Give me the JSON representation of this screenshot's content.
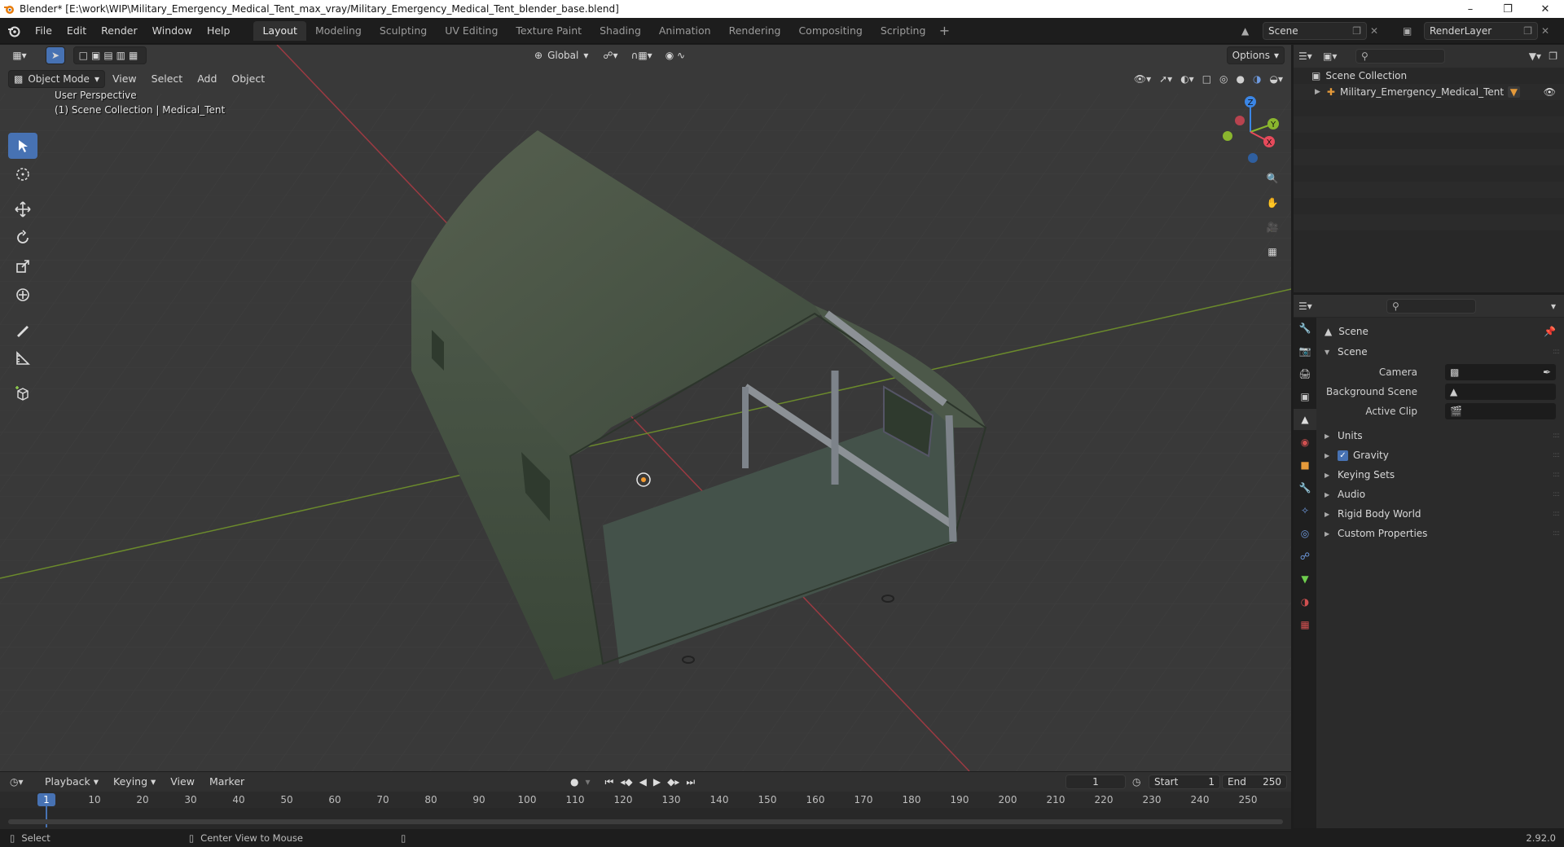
{
  "window": {
    "title": "Blender* [E:\\work\\WIP\\Military_Emergency_Medical_Tent_max_vray/Military_Emergency_Medical_Tent_blender_base.blend]"
  },
  "menu": [
    "File",
    "Edit",
    "Render",
    "Window",
    "Help"
  ],
  "workspaces": {
    "active": "Layout",
    "tabs": [
      "Layout",
      "Modeling",
      "Sculpting",
      "UV Editing",
      "Texture Paint",
      "Shading",
      "Animation",
      "Rendering",
      "Compositing",
      "Scripting"
    ]
  },
  "top_right": {
    "scene": "Scene",
    "view_layer": "RenderLayer"
  },
  "viewport": {
    "transform_orientation": "Global",
    "options_label": "Options",
    "mode": "Object Mode",
    "header_menus": [
      "View",
      "Select",
      "Add",
      "Object"
    ],
    "overlay_line1": "User Perspective",
    "overlay_line2": "(1) Scene Collection | Medical_Tent",
    "gizmo_axes": {
      "x": "X",
      "y": "Y",
      "z": "Z"
    }
  },
  "outliner": {
    "root": "Scene Collection",
    "items": [
      {
        "label": "Military_Emergency_Medical_Tent"
      }
    ]
  },
  "properties": {
    "context": "Scene",
    "panel_title": "Scene",
    "fields": [
      {
        "label": "Camera",
        "value": ""
      },
      {
        "label": "Background Scene",
        "value": ""
      },
      {
        "label": "Active Clip",
        "value": ""
      }
    ],
    "sections": [
      {
        "label": "Units",
        "checkbox": false
      },
      {
        "label": "Gravity",
        "checkbox": true,
        "checked": true
      },
      {
        "label": "Keying Sets",
        "checkbox": false
      },
      {
        "label": "Audio",
        "checkbox": false
      },
      {
        "label": "Rigid Body World",
        "checkbox": false
      },
      {
        "label": "Custom Properties",
        "checkbox": false
      }
    ]
  },
  "timeline": {
    "menus": [
      "Playback",
      "Keying",
      "View",
      "Marker"
    ],
    "current_frame": "1",
    "start_label": "Start",
    "start": "1",
    "end_label": "End",
    "end": "250",
    "ticks": [
      "1",
      "10",
      "20",
      "30",
      "40",
      "50",
      "60",
      "70",
      "80",
      "90",
      "100",
      "110",
      "120",
      "130",
      "140",
      "150",
      "160",
      "170",
      "180",
      "190",
      "200",
      "210",
      "220",
      "230",
      "240",
      "250"
    ]
  },
  "status": {
    "left": "Select",
    "middle": "Center View to Mouse",
    "version": "2.92.0"
  },
  "colors": {
    "accent": "#4772b3",
    "x_axis": "#e64a5b",
    "y_axis": "#8ab62e",
    "z_axis": "#3b86e6",
    "viewport_bg": "#393939",
    "tent": "#4a5547"
  }
}
